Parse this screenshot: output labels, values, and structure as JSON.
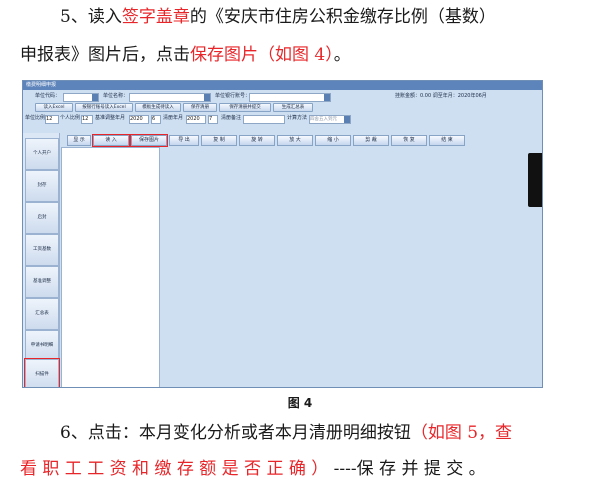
{
  "para5": {
    "l1_a": "5、读入",
    "l1_red": "签字盖章",
    "l1_b": "的《安庆市住房公积金缴存比例（基数）",
    "l2_a": "申报表》图片后，点击",
    "l2_red": "保存图片（如图 4）",
    "l2_b": "。"
  },
  "figure": {
    "window_title": "缴费明细申报",
    "row1": {
      "unit_code_label": "单位代码：",
      "unit_name_label": "单位名称：",
      "bank_account_label": "单位银行账号：",
      "info": "挂账金额：0.00 调至年月：2020年06月"
    },
    "row2": {
      "buttons": [
        "读入Excel",
        "按银行账号读入Excel",
        "模板生成待读入",
        "保存清册",
        "保存清册并提交",
        "生成汇总表"
      ]
    },
    "row3": {
      "unit_ratio_label": "单位比例",
      "unit_ratio": "12",
      "personal_ratio_label": "个人比例",
      "personal_ratio": "12",
      "base_year_label": "基准调整年月",
      "base_year": "2020",
      "base_month": "6",
      "clear_year_label": "清册年月",
      "clear_year": "2020",
      "clear_month": "7",
      "remark_label": "清册备注",
      "calc_label": "计算方法",
      "calc_value": "四舍五入到元"
    },
    "sidebar": [
      "个人开户",
      "封存",
      "启封",
      "工资基数",
      "基准调整",
      "汇总表",
      "申请书明细",
      "扫描件"
    ],
    "toolbar": [
      "显 示",
      "读 入",
      "保存图片",
      "导 出",
      "复 制",
      "旋 转",
      "放 大",
      "缩 小",
      "剪 裁",
      "恢 复",
      "结 束"
    ],
    "caption": "图 4"
  },
  "para6": {
    "l1_a": "6、点击：本月变化分析或者本月清册明细按钮",
    "l1_red": "（如图 5，查",
    "l2_red": "看 职 工 工 资 和 缴 存 额 是 否 正 确 ）",
    "l2_b": " ----保 存 并 提 交 。"
  }
}
